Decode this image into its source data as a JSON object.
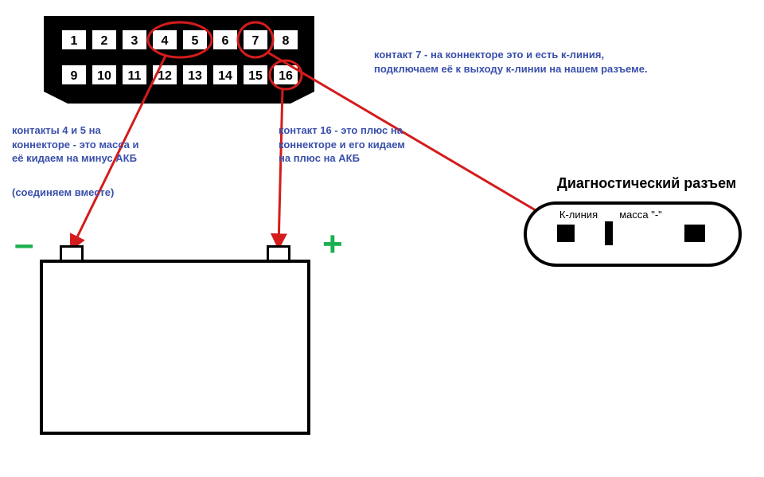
{
  "connector": {
    "pins_top": [
      "1",
      "2",
      "3",
      "4",
      "5",
      "6",
      "7",
      "8"
    ],
    "pins_bottom": [
      "9",
      "10",
      "11",
      "12",
      "13",
      "14",
      "15",
      "16"
    ]
  },
  "captions": {
    "pin7": "контакт 7 - на коннекторе это и есть к-линия, подключаем её к выходу к-линии на нашем разъеме.",
    "pin4_5_a": "контакты 4 и 5 на коннекторе - это масса и её кидаем на минус АКБ",
    "pin4_5_b": "(соединяем вместе)",
    "pin16": "контакт 16 - это плюс на коннекторе и его кидаем на плюс на АКБ"
  },
  "diag": {
    "title": "Диагностический разъем",
    "labels": {
      "kline": "К-линия",
      "mass": "масса \"-\""
    }
  },
  "symbols": {
    "minus": "–",
    "plus": "+"
  }
}
